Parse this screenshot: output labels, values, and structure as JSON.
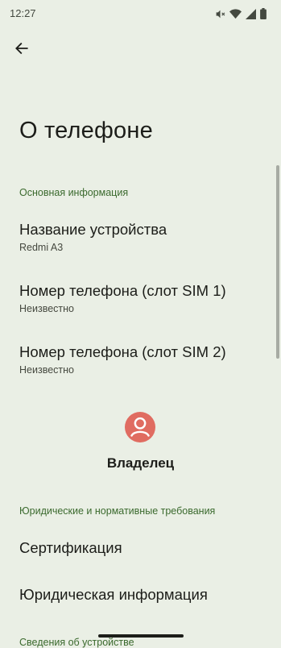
{
  "status_bar": {
    "time": "12:27",
    "icons": [
      "mute-icon",
      "wifi-icon",
      "cellular-signal-icon",
      "battery-icon"
    ]
  },
  "header": {
    "back_icon": "arrow-back-icon",
    "title": "О телефоне"
  },
  "sections": {
    "basic_info": "Основная информация",
    "legal": "Юридические и нормативные требования",
    "device_details": "Сведения об устройстве"
  },
  "items": {
    "device_name": {
      "title": "Название устройства",
      "summary": "Redmi A3"
    },
    "phone_sim1": {
      "title": "Номер телефона (слот SIM 1)",
      "summary": "Неизвестно"
    },
    "phone_sim2": {
      "title": "Номер телефона (слот SIM 2)",
      "summary": "Неизвестно"
    },
    "certification": {
      "title": "Сертификация"
    },
    "legal_info": {
      "title": "Юридическая информация"
    }
  },
  "owner": {
    "label": "Владелец",
    "icon": "account-circle-icon"
  },
  "colors": {
    "background": "#eaefe5",
    "accent": "#3b6a2e",
    "avatar": "#e06c61"
  }
}
